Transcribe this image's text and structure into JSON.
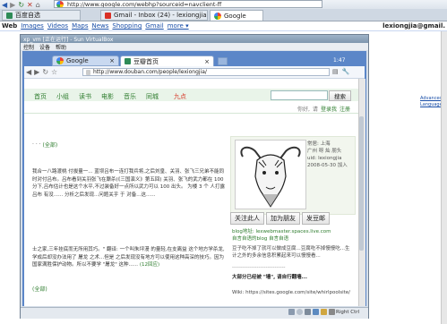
{
  "host_browser": {
    "address_url": "http://www.google.com/webhp?sourceid=navclient-ff",
    "tabs": [
      "百度自选",
      "Gmail - Inbox (24) - lexiongjia@gm...",
      "Google"
    ],
    "google_bar": {
      "links": [
        "Web",
        "Images",
        "Videos",
        "Maps",
        "News",
        "Shopping",
        "Gmail",
        "more ▾"
      ],
      "user": "lexiongjia@gmail.",
      "side_links": [
        "Advanced Search",
        "Language Tools"
      ]
    }
  },
  "vm_window": {
    "title": "xp_vm [正在运行] - Sun VirtualBox",
    "menu": [
      "控制",
      "设备",
      "帮助"
    ],
    "status_text": "Right Ctrl"
  },
  "guest_browser": {
    "tabs": [
      "Google",
      "豆瓣首页"
    ],
    "address_url": "http://www.douban.com/people/lexiongjia/",
    "clock": "1:47",
    "douban_nav": [
      "首页",
      "小组",
      "读书",
      "电影",
      "音乐",
      "同城",
      "九点"
    ],
    "search_button": "搜索",
    "user_links": [
      "你好,",
      "请",
      "登录我",
      "注册"
    ]
  },
  "profile": {
    "more_link": "(全部)",
    "paragraph1": "我合一八路渡桃 付拔量一... 蓝坝吕布一连打我兵将,之后刘皇、关羽、张飞三兄弟不能同时对付吕布。吕布看到关羽张飞在厮杀(《三国演义》第五回) 关羽、张飞的武力都在 100 分下,吕布估计也是这个水平,不过装备好一点所以武力可以 100 出头。 为楼 3 个 人打露 吕布 有没...... 分析之后发现...问题关乎 于 对备...这......",
    "paragraph2": "士之家,三年挂底而无所用其巧。\" 翻译: 一个叫朱坪漫 的量轻,在支离益 这个地方学杀龙,学成后却没办法用了 屠龙 之术...但是 之后发现没有地方可以使用这种高深的技巧。因为国家满胜保护动物。所以不要学 \"屠龙\" 这种......",
    "paragraph2_more": "(12回应)",
    "info": {
      "location": "常居: 上海",
      "handle": "广州 呀 灿 朋头",
      "uid": "uid: lexiongjia",
      "joined": "2008-05-30 加入"
    },
    "actions": [
      "关注此人",
      "加为朋友",
      "发豆邮"
    ],
    "blog_line1": "blog地址: lexwebmaster.spaces.live.com",
    "blog_line2": "自言自语的blog  自言自语",
    "bio": "豆子吃不掉了就可以做成豆腐...豆腐吃不掉慢慢吃...生计之外的多余信息积累起来可以慢慢看...",
    "divider": "------------------------------",
    "notice": "大部分已经被 \"墙\", 请自行翻墙...",
    "wiki": "Wiki: https://sites.google.com/site/whirlpoolsite/"
  }
}
